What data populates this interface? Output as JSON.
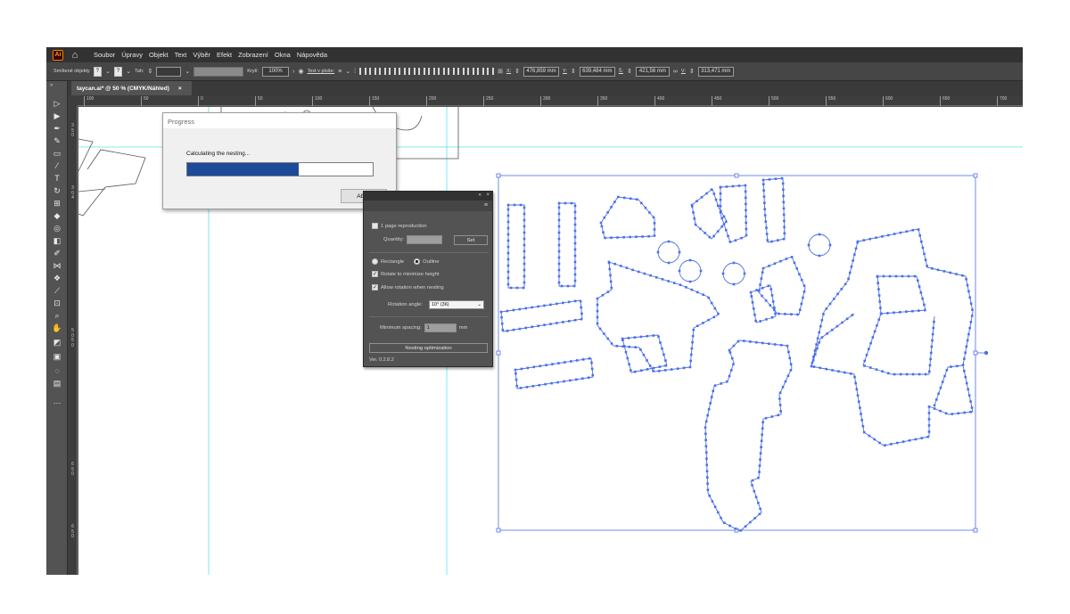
{
  "menubar": {
    "logo": "Ai",
    "items": [
      "Soubor",
      "Úpravy",
      "Objekt",
      "Text",
      "Výběr",
      "Efekt",
      "Zobrazení",
      "Okna",
      "Nápověda"
    ]
  },
  "controlbar": {
    "selection_label": "Smíšené objekty",
    "q1": "?",
    "q2": "?",
    "stroke_label": "Tah:",
    "opacity_label": "Krytí:",
    "opacity_value": "100%",
    "text_on_path_label": "Text v ploše:",
    "x_label": "X:",
    "x_value": "476,859 mm",
    "y_label": "Y:",
    "y_value": "639,484 mm",
    "w_label": "Š:",
    "w_value": "421,56 mm",
    "h_label": "V:",
    "h_value": "313,471 mm"
  },
  "document": {
    "tab_title": "taycan.ai* @ 50 % (CMYK/Náhled)",
    "close_glyph": "×"
  },
  "ruler": {
    "h_ticks": [
      "100",
      "50",
      "0",
      "50",
      "100",
      "150",
      "200",
      "250",
      "300",
      "350",
      "400",
      "450",
      "500",
      "550",
      "600",
      "650",
      "700"
    ],
    "v_labels": [
      "3",
      "5",
      "0",
      "3",
      "0",
      "4",
      "5",
      "0",
      "5",
      "0",
      "6",
      "5",
      "0",
      "6",
      "5",
      "0"
    ]
  },
  "progress_dialog": {
    "title": "Progress",
    "message": "Calculating the nesting...",
    "progress": 0.6,
    "abort_label": "Abort",
    "fill_color": "#1e4a9a"
  },
  "nesting_panel": {
    "page_reproduction_label": "1 page reproduction",
    "page_reproduction_checked": false,
    "quantity_label": "Quantity:",
    "set_label": "Set",
    "rectangle_label": "Rectangle",
    "outline_label": "Outline",
    "outline_selected": true,
    "rotate_min_height_label": "Rotate to minimize height",
    "rotate_min_height_checked": true,
    "allow_rotation_label": "Allow rotation when nesting",
    "allow_rotation_checked": true,
    "rotation_angle_label": "Rotation angle:",
    "rotation_angle_value": "10°  (36)",
    "min_spacing_label": "Minimum spacing:",
    "min_spacing_value": "1",
    "min_spacing_unit": "mm",
    "optimize_label": "Nesting optimization",
    "version": "Ver. 0.2.8.2"
  },
  "colors": {
    "selection_blue": "#4a6fe8",
    "guide_cyan": "#5ee0ef",
    "ui_dark": "#535353"
  }
}
